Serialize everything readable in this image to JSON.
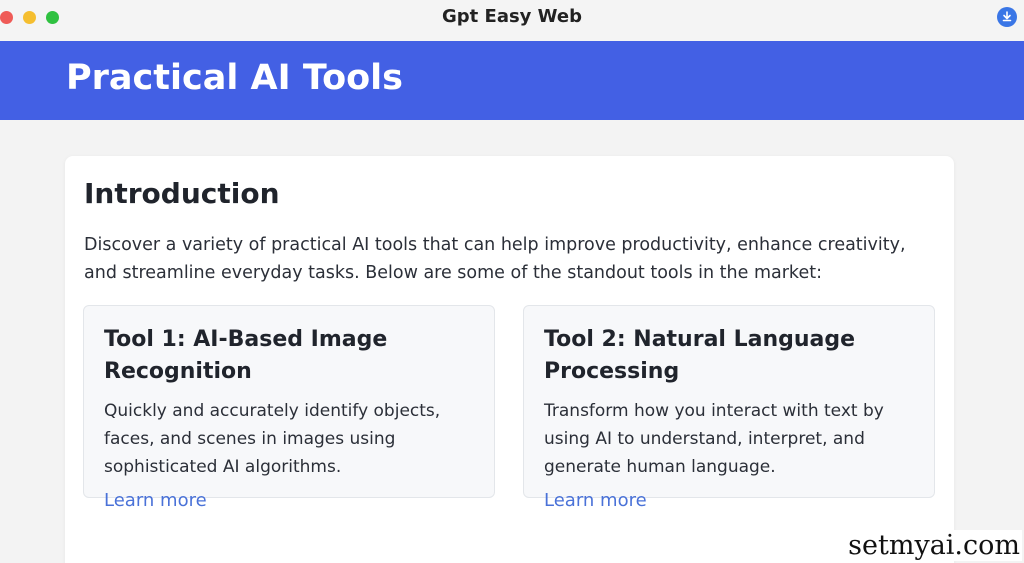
{
  "window": {
    "title": "Gpt Easy Web",
    "icons": {
      "download": "download-icon"
    },
    "colors": {
      "close": "#ef5b57",
      "minimize": "#f5be2f",
      "maximize": "#2fc140"
    }
  },
  "header": {
    "title": "Practical AI Tools",
    "background": "#4360e4"
  },
  "intro": {
    "heading": "Introduction",
    "text": "Discover a variety of practical AI tools that can help improve productivity, enhance creativity, and streamline everyday tasks. Below are some of the standout tools in the market:"
  },
  "tools": [
    {
      "title": "Tool 1: AI-Based Image Recognition",
      "description": "Quickly and accurately identify objects, faces, and scenes in images using sophisticated AI algorithms.",
      "link_label": "Learn more"
    },
    {
      "title": "Tool 2: Natural Language Processing",
      "description": "Transform how you interact with text by using AI to understand, interpret, and generate human language.",
      "link_label": "Learn more"
    }
  ],
  "watermark": "setmyai.com"
}
